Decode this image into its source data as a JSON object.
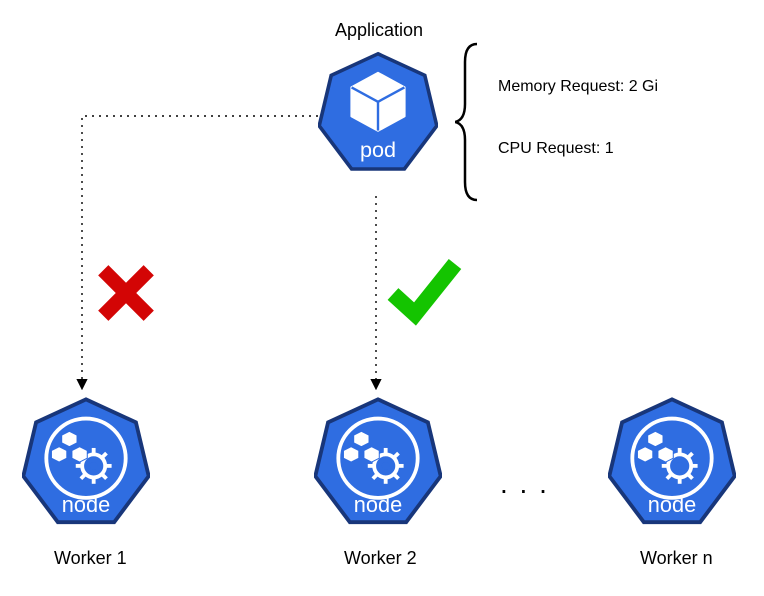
{
  "title": "Application",
  "pod": {
    "label": "pod",
    "color": "#2f6de1"
  },
  "requests": {
    "memory": "Memory Request: 2 Gi",
    "cpu": "CPU Request: 1"
  },
  "nodes": [
    {
      "label": "node",
      "caption": "Worker 1",
      "accepted": false
    },
    {
      "label": "node",
      "caption": "Worker 2",
      "accepted": true
    },
    {
      "label": "node",
      "caption": "Worker n",
      "accepted": null
    }
  ],
  "ellipsis": ". . .",
  "colors": {
    "blue": "#2f6de1",
    "green": "#14c400",
    "red": "#d30505",
    "black": "#000000"
  }
}
